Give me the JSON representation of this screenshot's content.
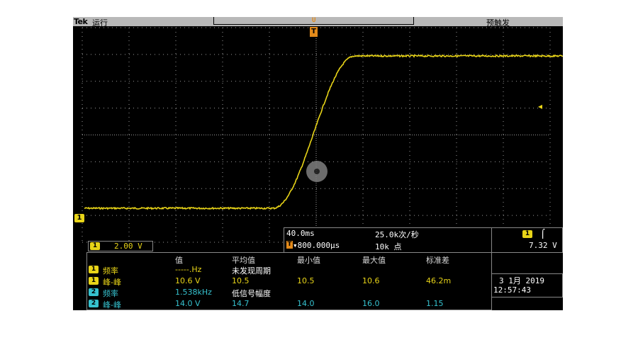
{
  "header": {
    "brand": "Tek",
    "run_state": "运行",
    "trigger_state": "预触发",
    "record_marker": "U",
    "trigger_position_label": "T"
  },
  "channel1": {
    "marker_label": "1",
    "scale": "2.00 V",
    "color": "#e8d418"
  },
  "horizontal": {
    "time_per_div": "40.0ms",
    "sample_rate": "25.0k次/秒",
    "trigger_badge": "T",
    "delay": "▾800.000μs",
    "record_length": "10k 点"
  },
  "trigger": {
    "source": "1",
    "edge_icon": "rising-edge",
    "level": "7.32 V"
  },
  "measurements": {
    "headers": [
      "值",
      "平均值",
      "最小值",
      "最大值",
      "标准差"
    ],
    "rows": [
      {
        "ch": "1",
        "name": "频率",
        "value": "-----.Hz",
        "mean": "未发现周期",
        "min": "",
        "max": "",
        "std": "",
        "color": "#e8d418"
      },
      {
        "ch": "1",
        "name": "峰-峰",
        "value": "10.6 V",
        "mean": "10.5",
        "min": "10.5",
        "max": "10.6",
        "std": "46.2m",
        "color": "#e8d418"
      },
      {
        "ch": "2",
        "name": "频率",
        "value": "1.538kHz",
        "mean": "低信号幅度",
        "min": "",
        "max": "",
        "std": "",
        "color": "#36c2cf"
      },
      {
        "ch": "2",
        "name": "峰-峰",
        "value": "14.0 V",
        "mean": "14.7",
        "min": "14.0",
        "max": "16.0",
        "std": "1.15",
        "color": "#36c2cf"
      }
    ]
  },
  "datetime": {
    "date": "3 1月  2019",
    "time": "12:57:43"
  },
  "colors": {
    "trace": "#e8d418",
    "trigger_orange": "#e38a1a",
    "ch2_cyan": "#36c2cf",
    "grid": "#9a9a9a"
  }
}
